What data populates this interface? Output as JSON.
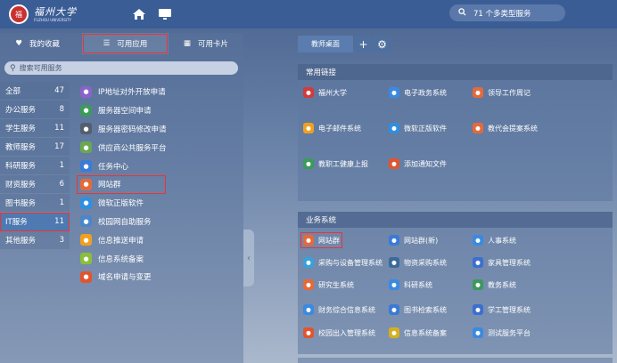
{
  "header": {
    "logo_cn": "福州大学",
    "logo_en": "FUZHOU UNIVERSITY",
    "logo_seal": "福",
    "search_text": "71 个多类型服务"
  },
  "left": {
    "tabs": [
      {
        "label": "我的收藏",
        "icon": "heart-icon"
      },
      {
        "label": "可用应用",
        "icon": "list-icon"
      },
      {
        "label": "可用卡片",
        "icon": "grid-icon"
      }
    ],
    "search_placeholder": "搜索可用服务",
    "categories": [
      {
        "name": "全部",
        "count": "47"
      },
      {
        "name": "办公服务",
        "count": "8"
      },
      {
        "name": "学生服务",
        "count": "11"
      },
      {
        "name": "教师服务",
        "count": "17"
      },
      {
        "name": "科研服务",
        "count": "1"
      },
      {
        "name": "财资服务",
        "count": "6"
      },
      {
        "name": "图书服务",
        "count": "1"
      },
      {
        "name": "IT服务",
        "count": "11"
      },
      {
        "name": "其他服务",
        "count": "3"
      }
    ],
    "apps": [
      {
        "label": "IP地址对外开放申请",
        "color": "#8a63c9"
      },
      {
        "label": "服务器空间申请",
        "color": "#3c9a5a"
      },
      {
        "label": "服务器密码修改申请",
        "color": "#555e6e"
      },
      {
        "label": "供应商公共服务平台",
        "color": "#6aa84f"
      },
      {
        "label": "任务中心",
        "color": "#3b7bd6"
      },
      {
        "label": "网站群",
        "color": "#e56a3a"
      },
      {
        "label": "微软正版软件",
        "color": "#2f8fe0"
      },
      {
        "label": "校园网自助服务",
        "color": "#4a86c8"
      },
      {
        "label": "信息推送申请",
        "color": "#f0a020"
      },
      {
        "label": "信息系统备案",
        "color": "#8bbf3a"
      },
      {
        "label": "域名申请与变更",
        "color": "#e0552f"
      }
    ]
  },
  "right": {
    "tabs": [
      {
        "label": "教师桌面"
      },
      {
        "label": "+"
      },
      {
        "label": "⚙"
      }
    ],
    "common_links": {
      "title": "常用链接",
      "items": [
        {
          "label": "福州大学",
          "color": "#d43a3a"
        },
        {
          "label": "电子政务系统",
          "color": "#3b8ae0"
        },
        {
          "label": "领导工作周记",
          "color": "#e56a3a"
        },
        {
          "label": "电子邮件系统",
          "color": "#f0a020"
        },
        {
          "label": "微软正版软件",
          "color": "#2f8fe0"
        },
        {
          "label": "教代会提案系统",
          "color": "#e56a3a"
        },
        {
          "label": "教职工健康上报",
          "color": "#3c9a5a"
        },
        {
          "label": "添加通知文件",
          "color": "#e0552f"
        }
      ]
    },
    "business": {
      "title": "业务系统",
      "items": [
        {
          "label": "网站群",
          "color": "#e56a3a"
        },
        {
          "label": "网站群(新)",
          "color": "#3b7bd6"
        },
        {
          "label": "人事系统",
          "color": "#3b8ae0"
        },
        {
          "label": "采购与设备管理系统",
          "color": "#3aa0d8"
        },
        {
          "label": "物资采购系统",
          "color": "#3a6a9a"
        },
        {
          "label": "家具管理系统",
          "color": "#3b6fd0"
        },
        {
          "label": "研究生系统",
          "color": "#e56a3a"
        },
        {
          "label": "科研系统",
          "color": "#3b8ae0"
        },
        {
          "label": "教务系统",
          "color": "#3c9a5a"
        },
        {
          "label": "财务综合信息系统",
          "color": "#3b8ae0"
        },
        {
          "label": "图书检索系统",
          "color": "#3b7bd6"
        },
        {
          "label": "学工管理系统",
          "color": "#3b6fd0"
        },
        {
          "label": "校园出入管理系统",
          "color": "#e0552f"
        },
        {
          "label": "信息系统备案",
          "color": "#d4b020"
        },
        {
          "label": "测试服务平台",
          "color": "#3b8ae0"
        }
      ]
    }
  }
}
